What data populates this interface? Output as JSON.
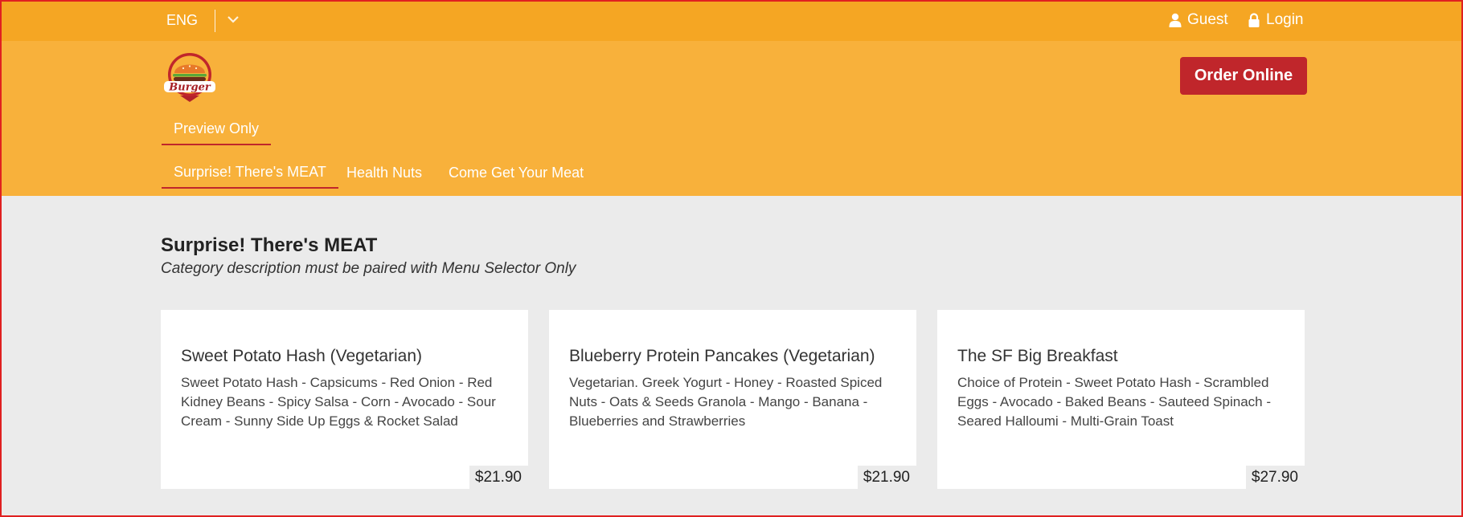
{
  "topbar": {
    "language": "ENG",
    "guest_label": "Guest",
    "login_label": "Login"
  },
  "header": {
    "logo_text": "Burger",
    "order_button": "Order Online",
    "menu_tabs": [
      {
        "label": "Preview Only",
        "active": true
      }
    ],
    "category_tabs": [
      {
        "label": "Surprise! There's MEAT",
        "active": true
      },
      {
        "label": "Health Nuts",
        "active": false
      },
      {
        "label": "Come Get Your Meat",
        "active": false
      }
    ]
  },
  "category": {
    "title": "Surprise! There's MEAT",
    "description": "Category description must be paired with Menu Selector Only"
  },
  "items": [
    {
      "name": "Sweet Potato Hash (Vegetarian)",
      "description": "Sweet Potato Hash - Capsicums - Red Onion - Red Kidney Beans - Spicy Salsa - Corn - Avocado - Sour Cream - Sunny Side Up Eggs & Rocket Salad",
      "price": "$21.90"
    },
    {
      "name": "Blueberry Protein Pancakes (Vegetarian)",
      "description": "Vegetarian. Greek Yogurt - Honey - Roasted Spiced Nuts - Oats & Seeds Granola - Mango - Banana - Blueberries and Strawberries",
      "price": "$21.90"
    },
    {
      "name": "The SF Big Breakfast",
      "description": "Choice of Protein - Sweet Potato Hash - Scrambled Eggs - Avocado - Baked Beans - Sauteed Spinach - Seared Halloumi - Multi-Grain Toast",
      "price": "$27.90"
    }
  ],
  "colors": {
    "topbar": "#f5a623",
    "header": "#f8b13b",
    "accent": "#c0262b",
    "background": "#ebebeb"
  },
  "icons": [
    "chevron-down-icon",
    "user-icon",
    "lock-icon",
    "burger-logo"
  ]
}
